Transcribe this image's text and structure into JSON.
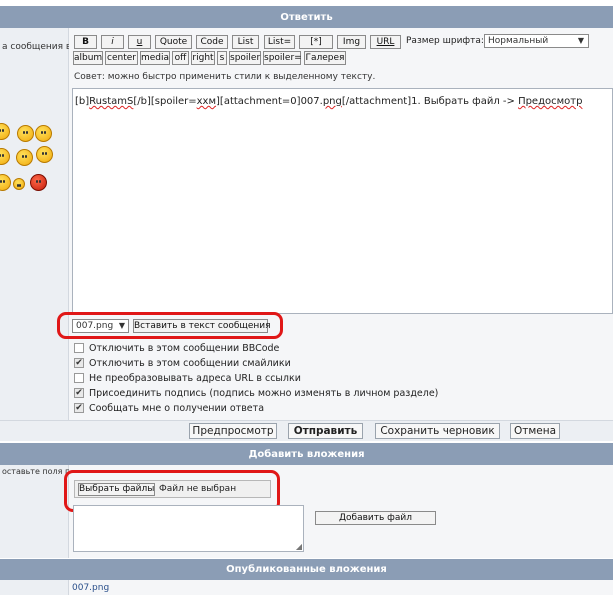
{
  "reply_header": "Ответить",
  "left_label_top": "а сообщения в",
  "toolbar": {
    "row1": [
      "B",
      "i",
      "u",
      "Quote",
      "Code",
      "List",
      "List=",
      "[*]",
      "Img",
      "URL"
    ],
    "row2": [
      "album",
      "center",
      "media",
      "off",
      "right",
      "s",
      "spoiler",
      "spoiler=",
      "Галерея"
    ],
    "font_size_label": "Размер шрифта:",
    "font_size_value": "Нормальный"
  },
  "tip": "Совет: можно быстро применить стили к выделенному тексту.",
  "editor": {
    "text_a": "[b]",
    "text_b": "RustamS",
    "text_c": "[/b][spoiler=",
    "text_d": "ххм",
    "text_e": "][attachment=0]007.",
    "text_f": "png",
    "text_g": "[/attachment]1. Выбрать файл -> ",
    "text_h": "Предосмотр"
  },
  "attachment_select": {
    "value": "007.png",
    "insert_button": "Вставить в текст сообщения"
  },
  "options": [
    {
      "label": "Отключить в этом сообщении BBCode",
      "checked": false
    },
    {
      "label": "Отключить в этом сообщении смайлики",
      "checked": true
    },
    {
      "label": "Не преобразовывать адреса URL в ссылки",
      "checked": false
    },
    {
      "label": "Присоединить подпись (подпись можно изменять в личном разделе)",
      "checked": true
    },
    {
      "label": "Сообщать мне о получении ответа",
      "checked": true
    }
  ],
  "actions": {
    "preview": "Предпросмотр",
    "submit": "Отправить",
    "save_draft": "Сохранить черновик",
    "cancel": "Отмена"
  },
  "attach_header": "Добавить вложения",
  "attach_hint": "оставьте поля пустыми",
  "file_input": {
    "choose_button": "Выбрать файлы",
    "no_file": "Файл не выбран"
  },
  "add_file_button": "Добавить файл",
  "published_header": "Опубликованные вложения",
  "published_file": "007.png"
}
